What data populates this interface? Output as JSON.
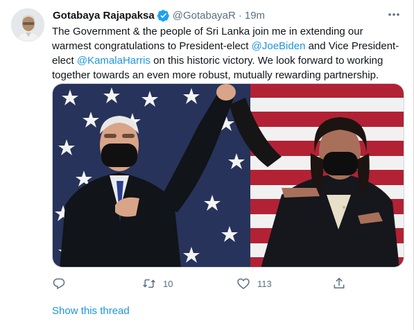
{
  "tweet": {
    "author_name": "Gotabaya Rajapaksa",
    "handle": "@GotabayaR",
    "separator": "·",
    "time": "19m",
    "text_1": "The Government & the people of Sri Lanka join me in extending our warmest congratulations to President-elect ",
    "mention_1": "@JoeBiden",
    "text_2": " and Vice President-elect ",
    "mention_2": "@KamalaHarris",
    "text_3": " on this historic victory. We look forward to working together towards an even more robust, mutually rewarding partnership.",
    "retweet_count": "10",
    "like_count": "113",
    "show_thread": "Show this thread"
  },
  "icons": {
    "verified": "verified-badge-icon",
    "more": "more-options-icon",
    "reply": "reply-icon",
    "retweet": "retweet-icon",
    "like": "like-icon",
    "share": "share-icon"
  },
  "colors": {
    "link": "#1b95e0",
    "secondary_text": "#5b7083",
    "verified": "#1da1f2"
  }
}
